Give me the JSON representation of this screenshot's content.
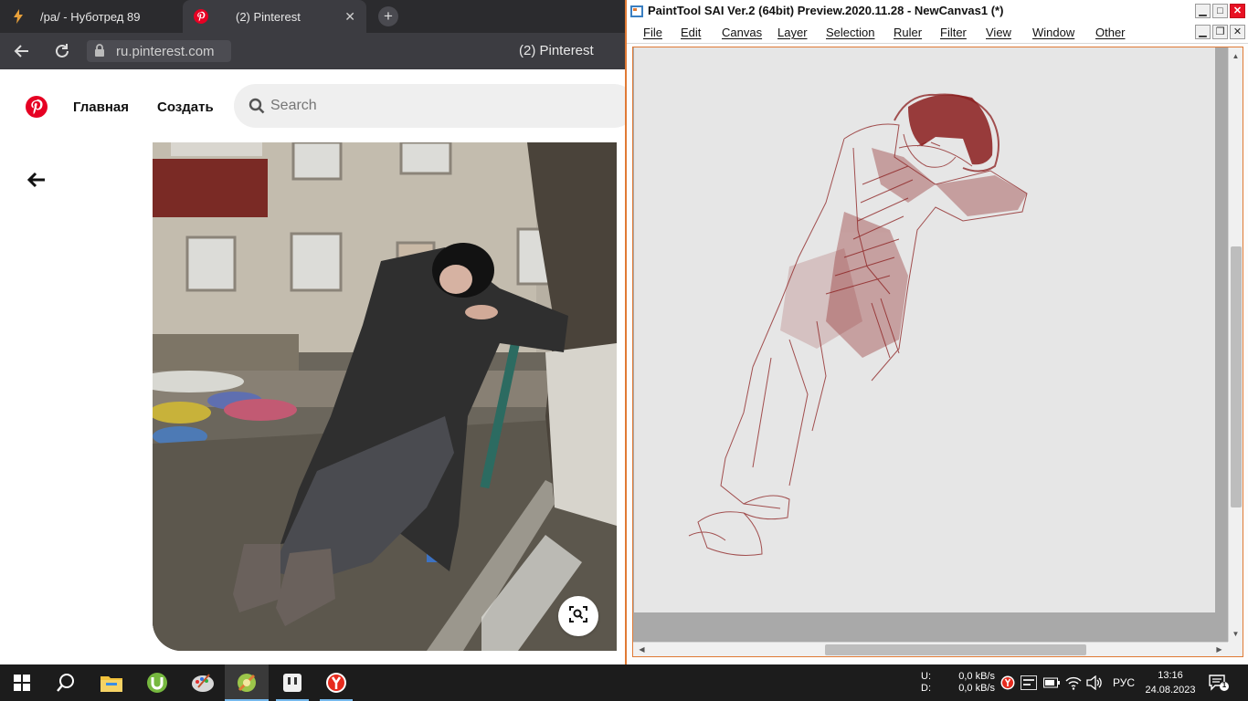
{
  "browser": {
    "tabs": [
      {
        "label": "/ра/ - Нуботред 89",
        "icon": "lightning-icon"
      },
      {
        "label": "(2) Pinterest",
        "icon": "pinterest-icon"
      }
    ],
    "url": "ru.pinterest.com",
    "page_title": "(2) Pinterest"
  },
  "pinterest": {
    "nav_home": "Главная",
    "nav_create": "Создать",
    "search_placeholder": "Search",
    "brand_color": "#e60023"
  },
  "sai": {
    "title": "PaintTool SAI Ver.2 (64bit) Preview.2020.11.28 - NewCanvas1 (*)",
    "menu": [
      "File",
      "Edit",
      "Canvas",
      "Layer",
      "Selection",
      "Ruler",
      "Filter",
      "View",
      "Window",
      "Other"
    ],
    "accent": "#e07a35",
    "sketch_color": "#8a1c1c"
  },
  "taskbar": {
    "net_up_label": "U:",
    "net_down_label": "D:",
    "net_up": "0,0 kB/s",
    "net_down": "0,0 kB/s",
    "lang": "РУС",
    "time": "13:16",
    "date": "24.08.2023",
    "notification_count": "1",
    "apps": [
      "windows-start-icon",
      "search-icon",
      "file-explorer-icon",
      "utorrent-icon",
      "paint-palette-icon",
      "painttool-sai-icon",
      "notes-icon",
      "yandex-browser-icon"
    ]
  }
}
